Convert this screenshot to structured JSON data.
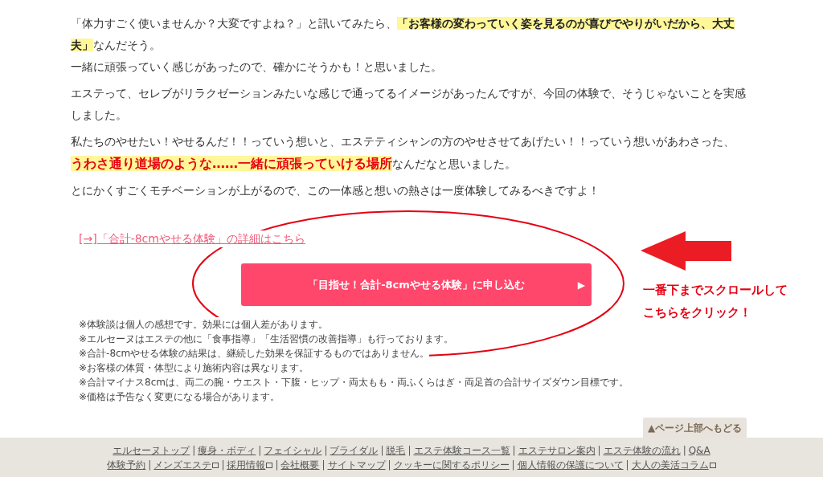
{
  "article": {
    "paragraphs": [
      {
        "lines": [
          [
            {
              "kind": "plain",
              "text": "「体力すごく使いませんか？大変ですよね？」と訊いてみたら、"
            },
            {
              "kind": "highlight",
              "text": "「お客様の変わっていく姿を見るのが喜びでやりがいだから、大丈夫」"
            },
            {
              "kind": "plain",
              "text": "なんだそう。"
            }
          ],
          [
            {
              "kind": "plain",
              "text": "一緒に頑張っていく感じがあったので、確かにそうかも！と思いました。"
            }
          ]
        ]
      },
      {
        "lines": [
          [
            {
              "kind": "plain",
              "text": "エステって、セレブがリラクゼーションみたいな感じで通ってるイメージがあったんですが、今回の体験で、そうじゃないことを実感しました。"
            }
          ]
        ]
      },
      {
        "lines": [
          [
            {
              "kind": "plain",
              "text": "私たちのやせたい！やせるんだ！！っていう想いと、エステティシャンの方のやせさせてあげたい！！っていう想いがあわさった、"
            },
            {
              "kind": "highlight-red",
              "text": "うわさ通り道場のような……一緒に頑張っていける場所"
            },
            {
              "kind": "plain",
              "text": "なんだなと思いました。"
            }
          ]
        ]
      },
      {
        "lines": [
          [
            {
              "kind": "plain",
              "text": "とにかくすごくモチベーションが上がるので、この一体感と想いの熱さは一度体験してみるべきですよ！"
            }
          ]
        ]
      }
    ],
    "detail_link": {
      "arrow": "[→]",
      "text": "「合計-8cmやせる体験」の詳細はこちら"
    },
    "apply_button": {
      "label": "「目指せ！合計-8cmやせる体験」に申し込む",
      "arrow": "▶"
    },
    "notes": [
      "※体験談は個人の感想です。効果には個人差があります。",
      "※エルセーヌはエステの他に「食事指導」「生活習慣の改善指導」も行っております。",
      "※合計-8cmやせる体験の結果は、継続した効果を保証するものではありません。",
      "※お客様の体質・体型により施術内容は異なります。",
      "※合計マイナス8cmは、両二の腕・ウエスト・下腹・ヒップ・両太もも・両ふくらはぎ・両足首の合計サイズダウン目標です。",
      "※価格は予告なく変更になる場合があります。"
    ]
  },
  "annotation": {
    "lines": [
      "一番下までスクロールして",
      "こちらをクリック！"
    ]
  },
  "back_to_top": "▲ページ上部へもどる",
  "footer": {
    "separator": "|",
    "rows": [
      {
        "links": [
          {
            "text": "エルセーヌトップ",
            "external": false
          },
          {
            "text": "痩身・ボディ",
            "external": false
          },
          {
            "text": "フェイシャル",
            "external": false
          },
          {
            "text": "ブライダル",
            "external": false
          },
          {
            "text": "脱毛",
            "external": false
          },
          {
            "text": "エステ体験コース一覧",
            "external": false
          },
          {
            "text": "エステサロン案内",
            "external": false
          },
          {
            "text": "エステ体験の流れ",
            "external": false
          },
          {
            "text": "Q&A",
            "external": false
          }
        ]
      },
      {
        "links": [
          {
            "text": "体験予約",
            "external": false
          },
          {
            "text": "メンズエステ",
            "external": true
          },
          {
            "text": "採用情報",
            "external": true
          },
          {
            "text": "会社概要",
            "external": false
          },
          {
            "text": "サイトマップ",
            "external": false
          },
          {
            "text": "クッキーに関するポリシー",
            "external": false
          },
          {
            "text": "個人情報の保護について",
            "external": false
          },
          {
            "text": "大人の美活コラム",
            "external": true
          }
        ]
      }
    ]
  }
}
